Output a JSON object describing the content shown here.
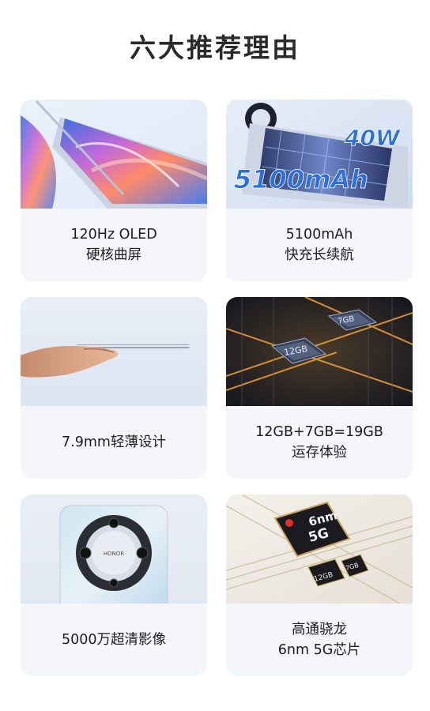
{
  "title": "六大推荐理由",
  "cards": [
    {
      "line1": "120Hz OLED",
      "line2": "硬核曲屏"
    },
    {
      "line1": "5100mAh",
      "line2": "快充长续航",
      "img_text_capacity": "5100mAh",
      "img_text_power": "40W"
    },
    {
      "line1": "7.9mm轻薄设计",
      "line2": ""
    },
    {
      "line1": "12GB+7GB=19GB",
      "line2": "运存体验",
      "img_chip_a": "12GB",
      "img_chip_b": "7GB"
    },
    {
      "line1": "5000万超清影像",
      "line2": "",
      "img_brand": "HONOR"
    },
    {
      "line1": "高通骁龙",
      "line2": "6nm 5G芯片",
      "img_chip_main": "6nm",
      "img_chip_main2": "5G",
      "img_chip_a": "12GB",
      "img_chip_b": "7GB"
    }
  ],
  "colors": {
    "card_bg": "#f4f6fa",
    "title": "#2a2a2a",
    "text": "#1d1d1d"
  }
}
